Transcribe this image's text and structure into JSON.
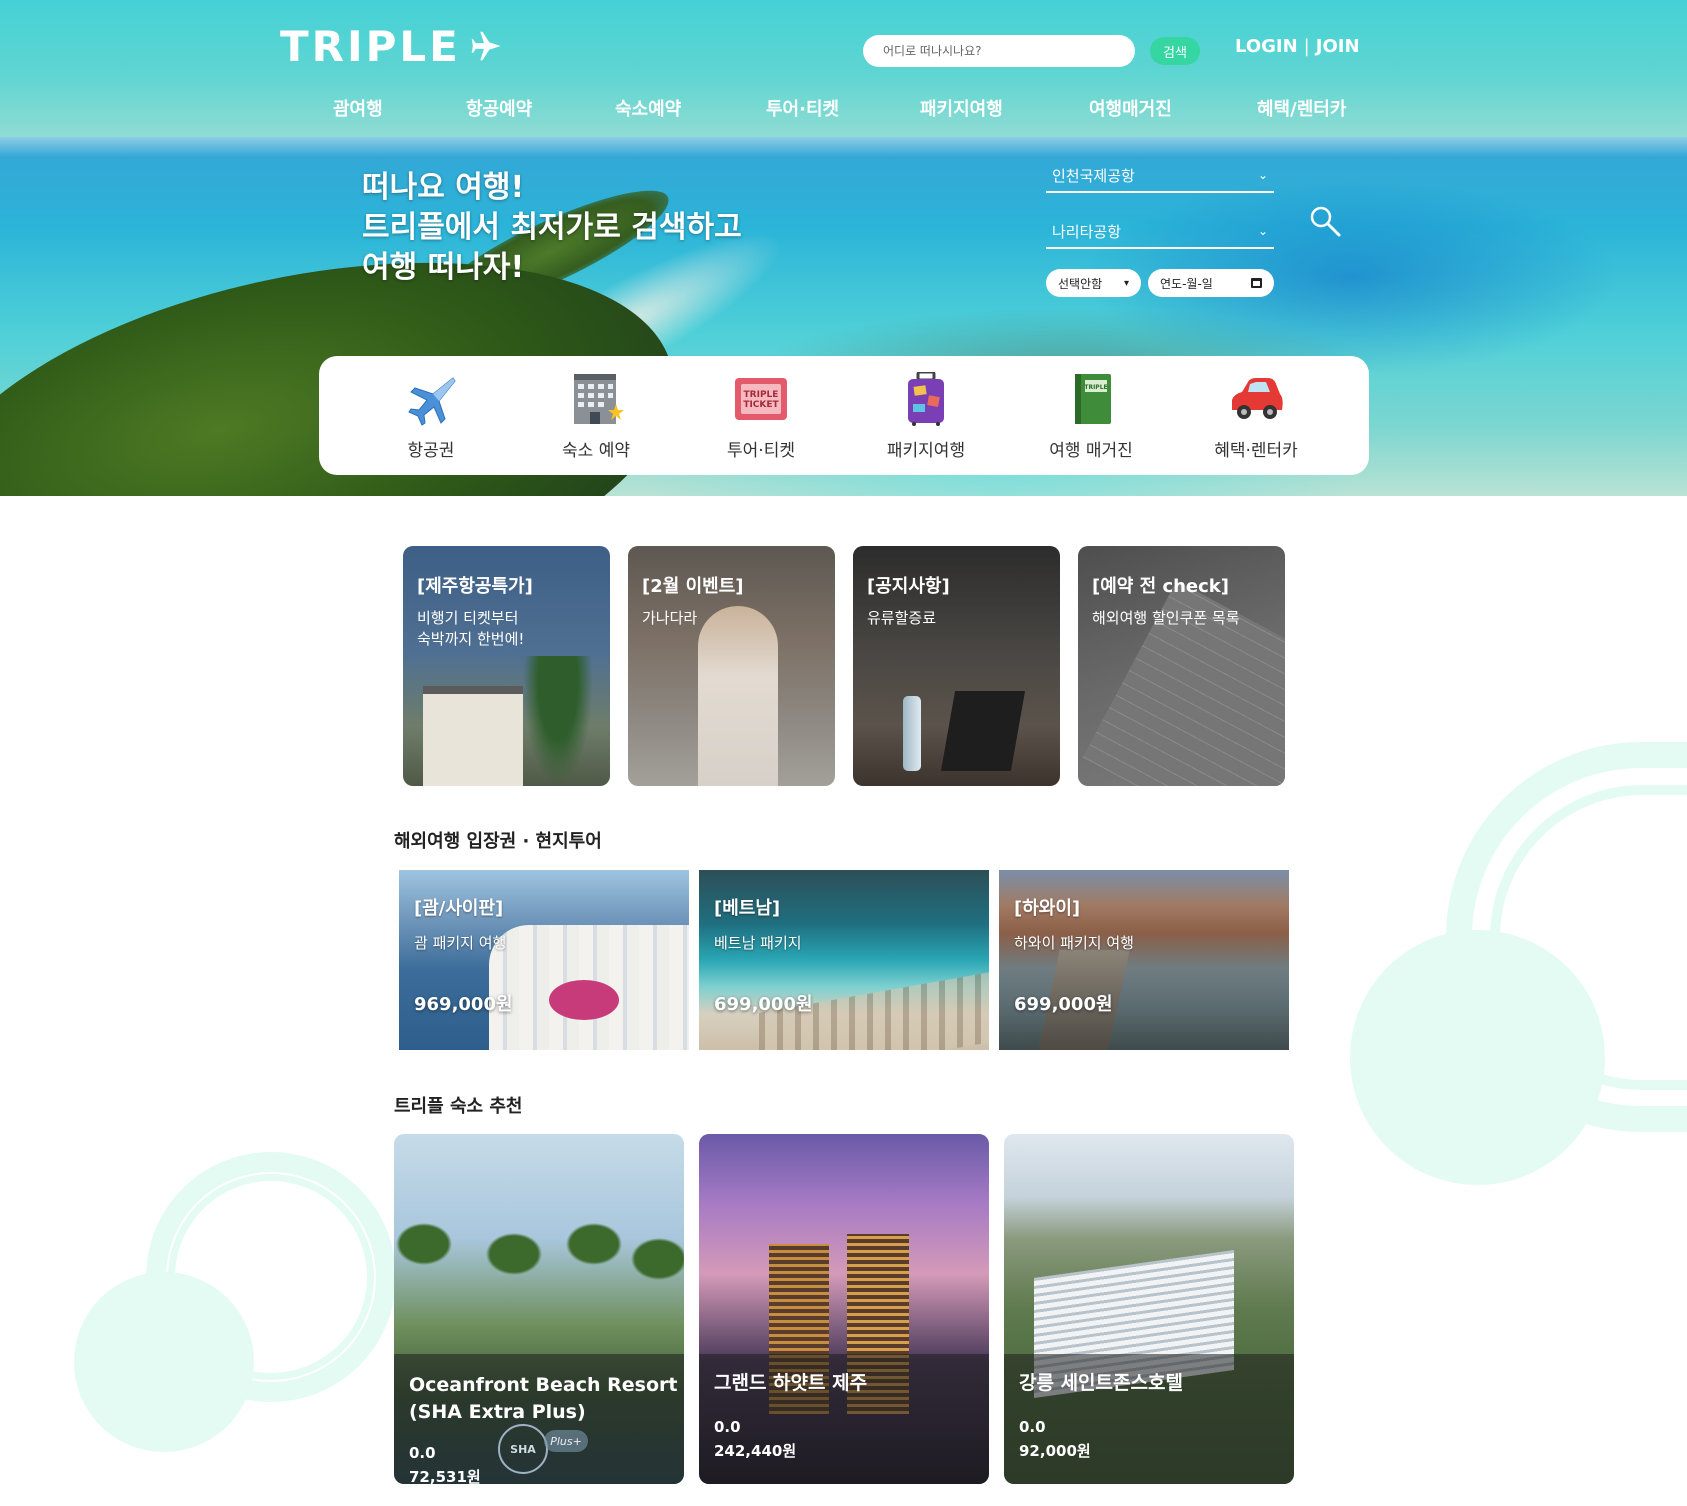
{
  "brand": {
    "logo_text": "TRIPLE"
  },
  "header": {
    "search_placeholder": "어디로 떠나시나요?",
    "search_button": "검색",
    "login": "LOGIN",
    "separator": "|",
    "join": "JOIN"
  },
  "nav": [
    "괌여행",
    "항공예약",
    "숙소예약",
    "투어·티켓",
    "패키지여행",
    "여행매거진",
    "혜택/렌터카"
  ],
  "hero": {
    "headline": [
      "떠나요 여행!",
      "트리플에서 최저가로 검색하고",
      "여행 떠나자!"
    ],
    "departure": "인천국제공항",
    "arrival": "나리타공항",
    "select_value": "선택안함",
    "date_placeholder": "연도-월-일"
  },
  "quick_menu": [
    {
      "label": "항공권",
      "icon": "airplane-icon"
    },
    {
      "label": "숙소 예약",
      "icon": "hotel-icon"
    },
    {
      "label": "투어·티켓",
      "icon": "ticket-icon"
    },
    {
      "label": "패키지여행",
      "icon": "luggage-icon"
    },
    {
      "label": "여행 매거진",
      "icon": "book-icon"
    },
    {
      "label": "혜택·렌터카",
      "icon": "car-icon"
    }
  ],
  "events": [
    {
      "title": "[제주항공특가]",
      "desc": [
        "비행기 티켓부터",
        "숙박까지 한번에!"
      ]
    },
    {
      "title": "[2월 이벤트]",
      "desc": [
        "가나다라"
      ]
    },
    {
      "title": "[공지사항]",
      "desc": [
        "유류할증료"
      ]
    },
    {
      "title": "[예약 전 check]",
      "desc": [
        "해외여행 할인쿠폰 목록"
      ]
    }
  ],
  "tour_section_title": "해외여행 입장권 · 현지투어",
  "tours": [
    {
      "title": "[괌/사이판]",
      "desc": "괌 패키지 여행",
      "price": "969,000원"
    },
    {
      "title": "[베트남]",
      "desc": "베트남 패키지",
      "price": "699,000원"
    },
    {
      "title": "[하와이]",
      "desc": "하와이 패키지 여행",
      "price": "699,000원"
    }
  ],
  "hotel_section_title": "트리플 숙소 추천",
  "hotels": [
    {
      "name": [
        "Oceanfront Beach Resort",
        "(SHA Extra Plus)"
      ],
      "rating": "0.0",
      "price": "72,531원",
      "badge": [
        "SHA",
        "Plus+"
      ]
    },
    {
      "name": [
        "그랜드 하얏트 제주"
      ],
      "rating": "0.0",
      "price": "242,440원"
    },
    {
      "name": [
        "강릉 세인트존스호텔"
      ],
      "rating": "0.0",
      "price": "92,000원"
    }
  ],
  "colors": {
    "header_teal": "#45d1d6",
    "search_button": "#35d6a1",
    "bubble_mint": "#d6f8ec"
  }
}
